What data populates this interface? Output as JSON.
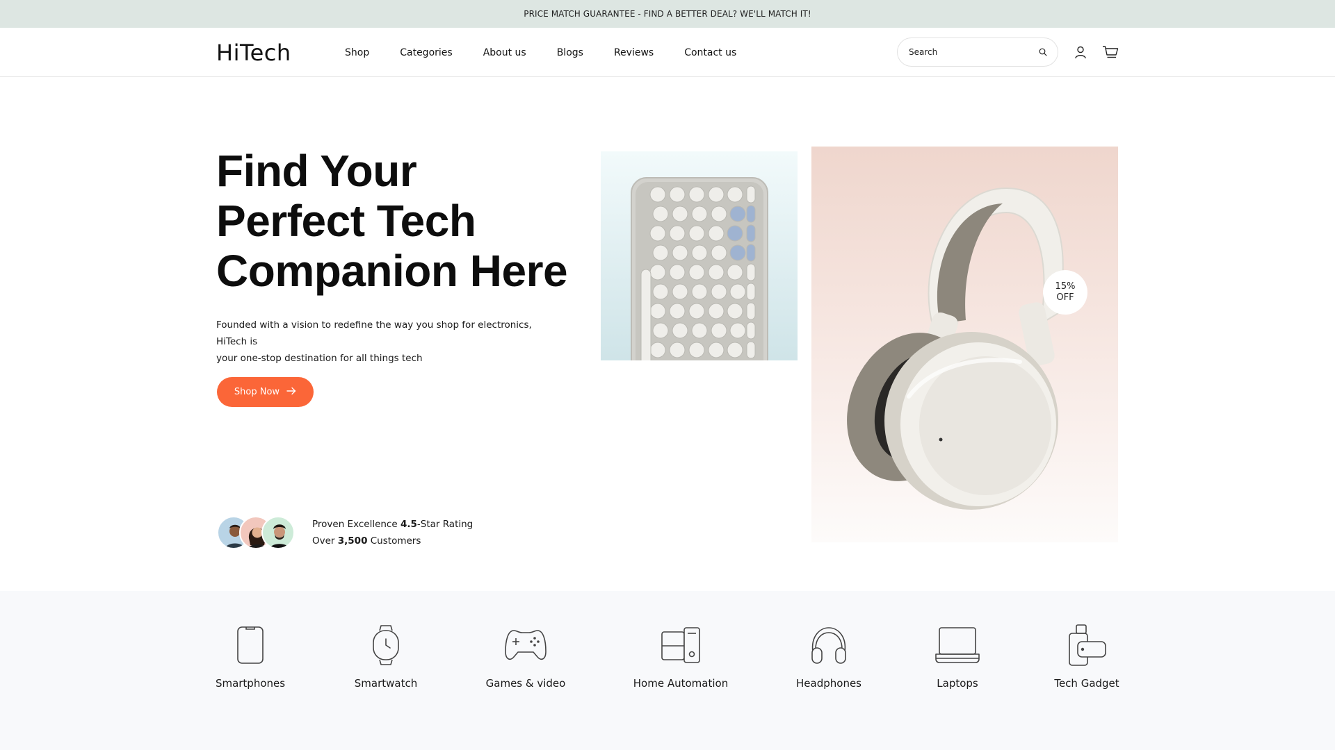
{
  "announcement": "PRICE MATCH GUARANTEE - FIND A BETTER DEAL? WE'LL MATCH IT!",
  "header": {
    "logo": "HiTech",
    "nav": [
      "Shop",
      "Categories",
      "About us",
      "Blogs",
      "Reviews",
      "Contact us"
    ],
    "search_placeholder": "Search",
    "icons": [
      "search-icon",
      "user-icon",
      "cart-icon"
    ]
  },
  "hero": {
    "title_lines": [
      "Find Your",
      "Perfect Tech",
      "Companion Here"
    ],
    "description_line1": "Founded with a vision to redefine the way you shop for electronics, HiTech is",
    "description_line2": "your one-stop destination for all things tech",
    "cta": "Shop Now",
    "badge_line1": "15%",
    "badge_line2": "OFF",
    "proof_line1_prefix": "Proven Excellence ",
    "proof_rating": "4.5",
    "proof_line1_suffix": "-Star Rating",
    "proof_line2_prefix": "Over ",
    "proof_customers": "3,500",
    "proof_line2_suffix": " Customers"
  },
  "categories": [
    {
      "label": "Smartphones",
      "icon": "smartphone-icon"
    },
    {
      "label": "Smartwatch",
      "icon": "smartwatch-icon"
    },
    {
      "label": "Games & video",
      "icon": "gamepad-icon"
    },
    {
      "label": "Home Automation",
      "icon": "home-automation-icon"
    },
    {
      "label": "Headphones",
      "icon": "headphones-icon"
    },
    {
      "label": "Laptops",
      "icon": "laptop-icon"
    },
    {
      "label": "Tech Gadget",
      "icon": "tech-gadget-icon"
    }
  ],
  "colors": {
    "announcement_bg": "#dde6e2",
    "accent": "#fb6638",
    "category_bg": "#f8f9fb"
  }
}
